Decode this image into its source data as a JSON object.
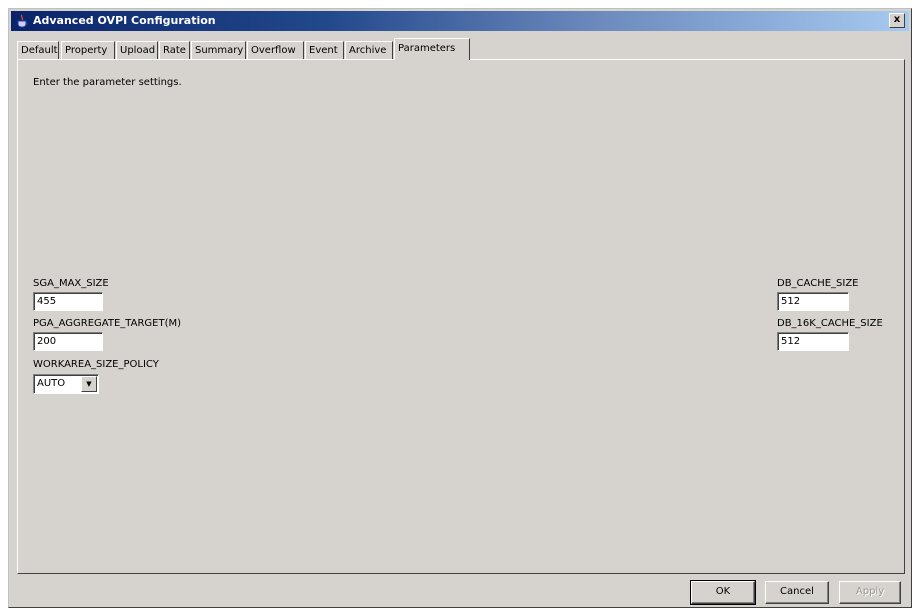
{
  "window": {
    "title": "Advanced OVPI Configuration",
    "close_symbol": "x",
    "icon": "java-cup-icon"
  },
  "tabs": [
    {
      "label": "Default",
      "active": false
    },
    {
      "label": "Property",
      "active": false
    },
    {
      "label": "Upload",
      "active": false
    },
    {
      "label": "Rate",
      "active": false
    },
    {
      "label": "Summary",
      "active": false
    },
    {
      "label": "Overflow",
      "active": false
    },
    {
      "label": "Event",
      "active": false
    },
    {
      "label": "Archive",
      "active": false
    },
    {
      "label": "Parameters",
      "active": true
    }
  ],
  "panel": {
    "instruction": "Enter the parameter settings.",
    "fields": {
      "sga_max_size": {
        "label": "SGA_MAX_SIZE",
        "value": "455"
      },
      "pga_aggregate_target": {
        "label": "PGA_AGGREGATE_TARGET(M)",
        "value": "200"
      },
      "workarea_size_policy": {
        "label": "WORKAREA_SIZE_POLICY",
        "value": "AUTO"
      },
      "db_cache_size": {
        "label": "DB_CACHE_SIZE",
        "value": "512"
      },
      "db_16k_cache_size": {
        "label": "DB_16K_CACHE_SIZE",
        "value": "512"
      }
    },
    "dropdown_symbol": "▼"
  },
  "buttons": {
    "ok": "OK",
    "cancel": "Cancel",
    "apply": "Apply"
  },
  "colors": {
    "title_gradient_start": "#0a246a",
    "title_gradient_end": "#a6caf0",
    "face": "#d6d3ce"
  }
}
